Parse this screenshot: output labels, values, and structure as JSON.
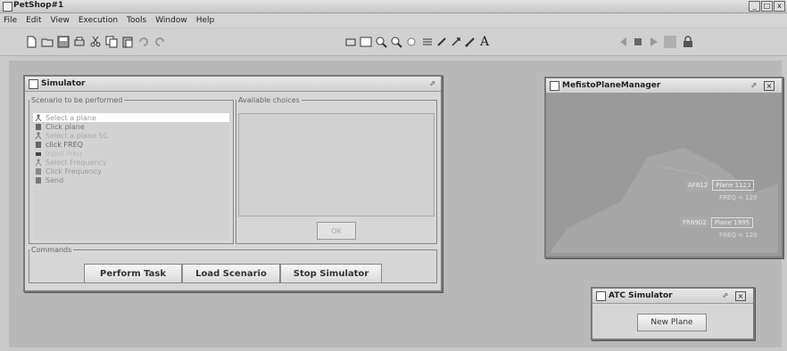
{
  "app": {
    "title": "PetShop#1",
    "window_buttons": [
      "_",
      "□",
      "x"
    ]
  },
  "menu": [
    "File",
    "Edit",
    "View",
    "Execution",
    "Tools",
    "Window",
    "Help"
  ],
  "toolbar": {
    "icons_left": [
      "new-file-icon",
      "open-folder-icon",
      "save-icon",
      "print-icon",
      "cut-icon",
      "copy-icon",
      "paste-icon",
      "undo-icon",
      "redo-icon"
    ],
    "icons_middle": [
      "print-preview-icon",
      "zoom-fit-icon",
      "zoom-in-icon",
      "zoom-out-icon",
      "zoom-reset-icon",
      "grid-icon",
      "pointer-icon",
      "select-arrow-icon",
      "connect-icon",
      "text-icon"
    ],
    "text_tool": "A",
    "icons_right": [
      "rewind-icon",
      "stop-icon",
      "play-icon",
      "step-icon",
      "lock-icon"
    ]
  },
  "simulator": {
    "title": "Simulator",
    "scenario_legend": "Scenario to be performed",
    "choices_legend": "Available choices",
    "ok_label": "OK",
    "scenario_items": [
      {
        "label": "Select a plane",
        "icon": "user-icon",
        "selected": true
      },
      {
        "label": "Click plane",
        "icon": "mouse-icon",
        "selected": false
      },
      {
        "label": "Select a plane SC",
        "icon": "user-icon",
        "selected": false
      },
      {
        "label": "click FREQ",
        "icon": "mouse-icon",
        "selected": false
      },
      {
        "label": "Input Freq",
        "icon": "keyboard-icon",
        "selected": false
      },
      {
        "label": "Select Frequency",
        "icon": "user-icon",
        "selected": false
      },
      {
        "label": "Click Frequency",
        "icon": "mouse-icon",
        "selected": false
      },
      {
        "label": "Send",
        "icon": "mouse-icon",
        "selected": false
      }
    ],
    "commands_legend": "Commands",
    "buttons": {
      "perform": "Perform Task",
      "load": "Load Scenario",
      "stop": "Stop Simulator"
    }
  },
  "plane_manager": {
    "title": "MefistoPlaneManager",
    "planes": [
      {
        "tag": "AF612",
        "name": "Plane 1123",
        "freq": "FREQ = 120"
      },
      {
        "tag": "FR8902",
        "name": "Plane 1995",
        "freq": "FREQ = 120"
      }
    ]
  },
  "atc": {
    "title": "ATC Simulator",
    "new_plane": "New Plane"
  }
}
